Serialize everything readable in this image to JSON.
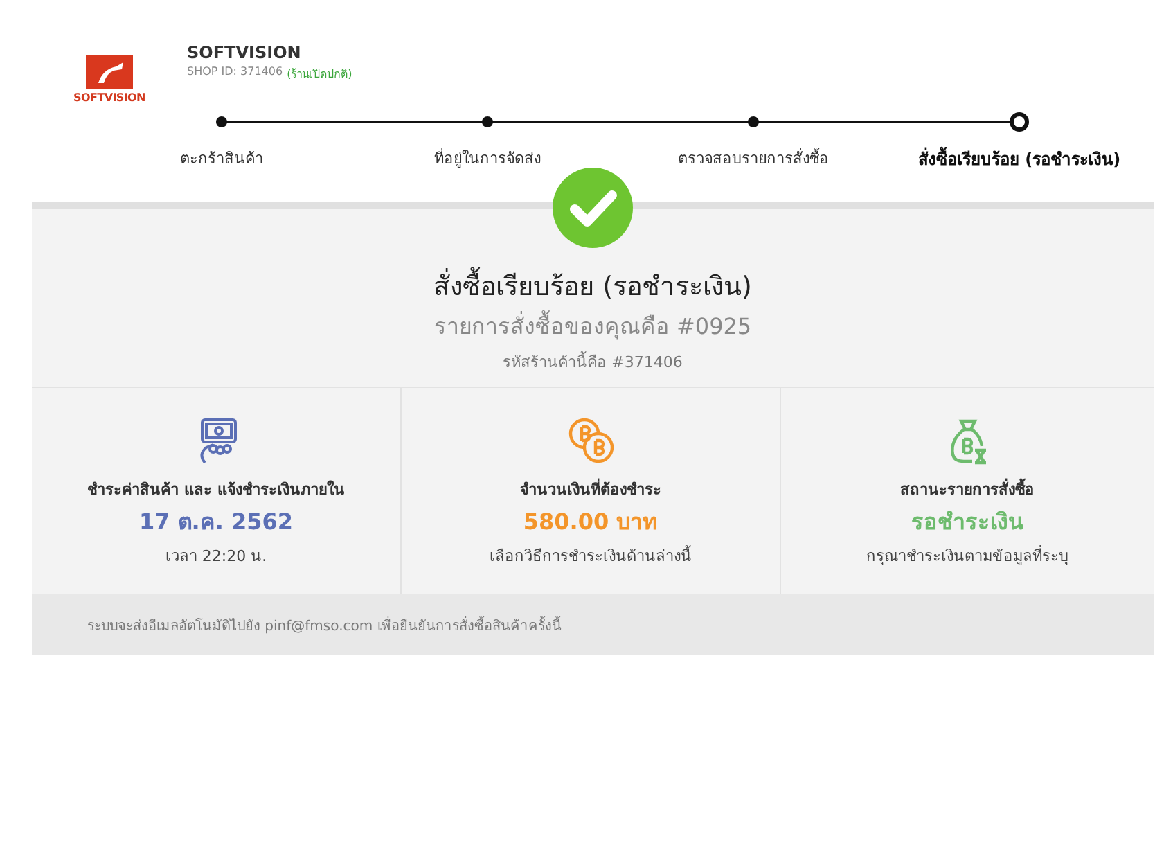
{
  "shop": {
    "logo_text": "SOFTVISION",
    "name": "SOFTVISION",
    "shop_id": "SHOP ID: 371406",
    "status": "(ร้านเปิดปกติ)"
  },
  "steps": [
    {
      "label": "ตะกร้าสินค้า",
      "selected": false
    },
    {
      "label": "ที่อยู่ในการจัดส่ง",
      "selected": false
    },
    {
      "label": "ตรวจสอบรายการสั่งซื้อ",
      "selected": false
    },
    {
      "label": "สั่งซื้อเรียบร้อย (รอชำระเงิน)",
      "selected": true
    }
  ],
  "result": {
    "title": "สั่งซื้อเรียบร้อย (รอชำระเงิน)",
    "order": "รายการสั่งซื้อของคุณคือ #0925",
    "shop_code": "รหัสร้านค้านี้คือ #371406"
  },
  "cards": [
    {
      "kind": "cash",
      "heading": "ชำระค่าสินค้า และ แจ้งชำระเงินภายใน",
      "value": "17 ต.ค. 2562",
      "note": "เวลา 22:20 น.",
      "color": "#5b6fb5"
    },
    {
      "kind": "coins",
      "heading": "จำนวนเงินที่ต้องชำระ",
      "value": "580.00 บาท",
      "note": "เลือกวิธีการชำระเงินด้านล่างนี้",
      "color": "#f3952a"
    },
    {
      "kind": "bag",
      "heading": "สถานะรายการสั่งซื้อ",
      "value": "รอชำระเงิน",
      "note": "กรุณาชำระเงินตามข้อมูลที่ระบุ",
      "color": "#6dbb6d"
    }
  ],
  "footer": "ระบบจะส่งอีเมลอัตโนมัติไปยัง pinf@fmso.com เพื่อยืนยันการสั่งซื้อสินค้าครั้งนี้"
}
